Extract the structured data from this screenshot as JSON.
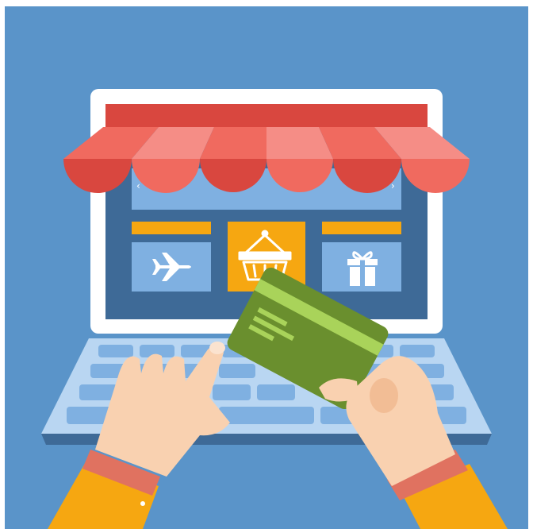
{
  "scene": {
    "subject": "online-shopping-illustration",
    "icons": [
      "airplane-icon",
      "shopping-basket-icon",
      "gift-icon"
    ],
    "colors": {
      "background": "#5a94c9",
      "screen_frame": "#ffffff",
      "screen_bezel": "#3e6a97",
      "screen_panel": "#7fb0e1",
      "awning_red": "#d9473f",
      "awning_coral": "#f06a5f",
      "awning_pink": "#f58d86",
      "accent_orange": "#f6a711",
      "keyboard": "#b9d6f2",
      "keys": "#7fb0e1",
      "card_green": "#6a8f2e",
      "card_stripe": "#a9d35a",
      "skin": "#f9d1b0",
      "sleeve": "#f6a711",
      "cuff": "#e07260"
    }
  }
}
